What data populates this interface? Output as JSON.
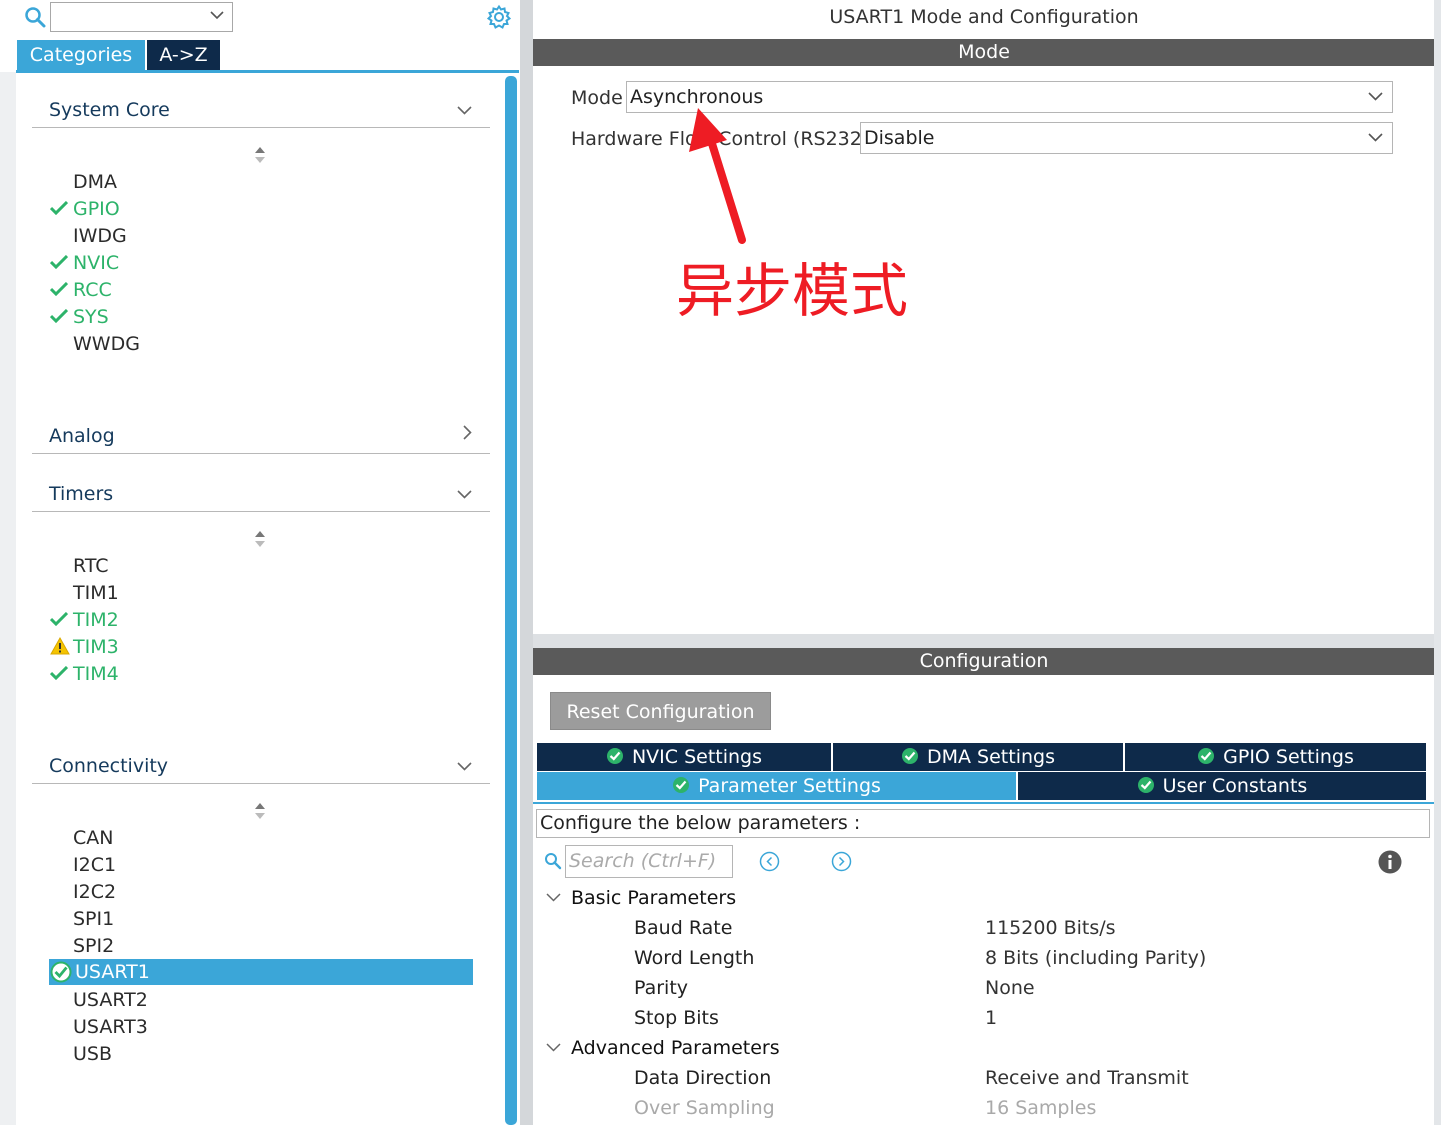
{
  "left": {
    "filter_value": "",
    "tabs": {
      "categories": "Categories",
      "az": "A->Z"
    },
    "categories": {
      "system_core": {
        "label": "System Core",
        "items": [
          {
            "label": "DMA",
            "status": "none"
          },
          {
            "label": "GPIO",
            "status": "ok"
          },
          {
            "label": "IWDG",
            "status": "none"
          },
          {
            "label": "NVIC",
            "status": "ok"
          },
          {
            "label": "RCC",
            "status": "ok"
          },
          {
            "label": "SYS",
            "status": "ok"
          },
          {
            "label": "WWDG",
            "status": "none"
          }
        ]
      },
      "analog": {
        "label": "Analog"
      },
      "timers": {
        "label": "Timers",
        "items": [
          {
            "label": "RTC",
            "status": "none"
          },
          {
            "label": "TIM1",
            "status": "none"
          },
          {
            "label": "TIM2",
            "status": "ok"
          },
          {
            "label": "TIM3",
            "status": "warning"
          },
          {
            "label": "TIM4",
            "status": "ok"
          }
        ]
      },
      "connectivity": {
        "label": "Connectivity",
        "items": [
          {
            "label": "CAN",
            "status": "none"
          },
          {
            "label": "I2C1",
            "status": "none"
          },
          {
            "label": "I2C2",
            "status": "none"
          },
          {
            "label": "SPI1",
            "status": "none"
          },
          {
            "label": "SPI2",
            "status": "none"
          },
          {
            "label": "USART1",
            "status": "selected-ok"
          },
          {
            "label": "USART2",
            "status": "none"
          },
          {
            "label": "USART3",
            "status": "none"
          },
          {
            "label": "USB",
            "status": "none"
          }
        ]
      }
    }
  },
  "right": {
    "title": "USART1 Mode and Configuration",
    "mode_section": "Mode",
    "mode_label": "Mode",
    "mode_value": "Asynchronous",
    "flow_label": "Hardware Flow Control (RS232)",
    "flow_value": "Disable",
    "annotation": "异步模式",
    "config_section": "Configuration",
    "reset_button": "Reset Configuration",
    "tabs": {
      "nvic": "NVIC Settings",
      "dma": "DMA Settings",
      "gpio": "GPIO Settings",
      "parameter": "Parameter Settings",
      "user_constants": "User Constants"
    },
    "config_desc": "Configure the below parameters :",
    "search_placeholder": "Search (Ctrl+F)",
    "groups": {
      "basic": {
        "label": "Basic Parameters",
        "params": [
          {
            "name": "Baud Rate",
            "value": "115200 Bits/s"
          },
          {
            "name": "Word Length",
            "value": "8 Bits (including Parity)"
          },
          {
            "name": "Parity",
            "value": "None"
          },
          {
            "name": "Stop Bits",
            "value": "1"
          }
        ]
      },
      "advanced": {
        "label": "Advanced Parameters",
        "params": [
          {
            "name": "Data Direction",
            "value": "Receive and Transmit"
          },
          {
            "name": "Over Sampling",
            "value": "16 Samples"
          }
        ]
      }
    }
  },
  "colors": {
    "accent_blue": "#3ba6d8",
    "navy": "#0e2a4a",
    "ok_green": "#2db36a",
    "annotation_red": "#ee1c24",
    "section_gray": "#5a5a5a"
  },
  "icons": [
    "search-icon",
    "gear-icon",
    "chevron-down-icon",
    "chevron-right-icon",
    "sort-icon",
    "check-icon",
    "warning-icon",
    "check-circle-icon",
    "prev-icon",
    "next-icon",
    "info-icon"
  ]
}
